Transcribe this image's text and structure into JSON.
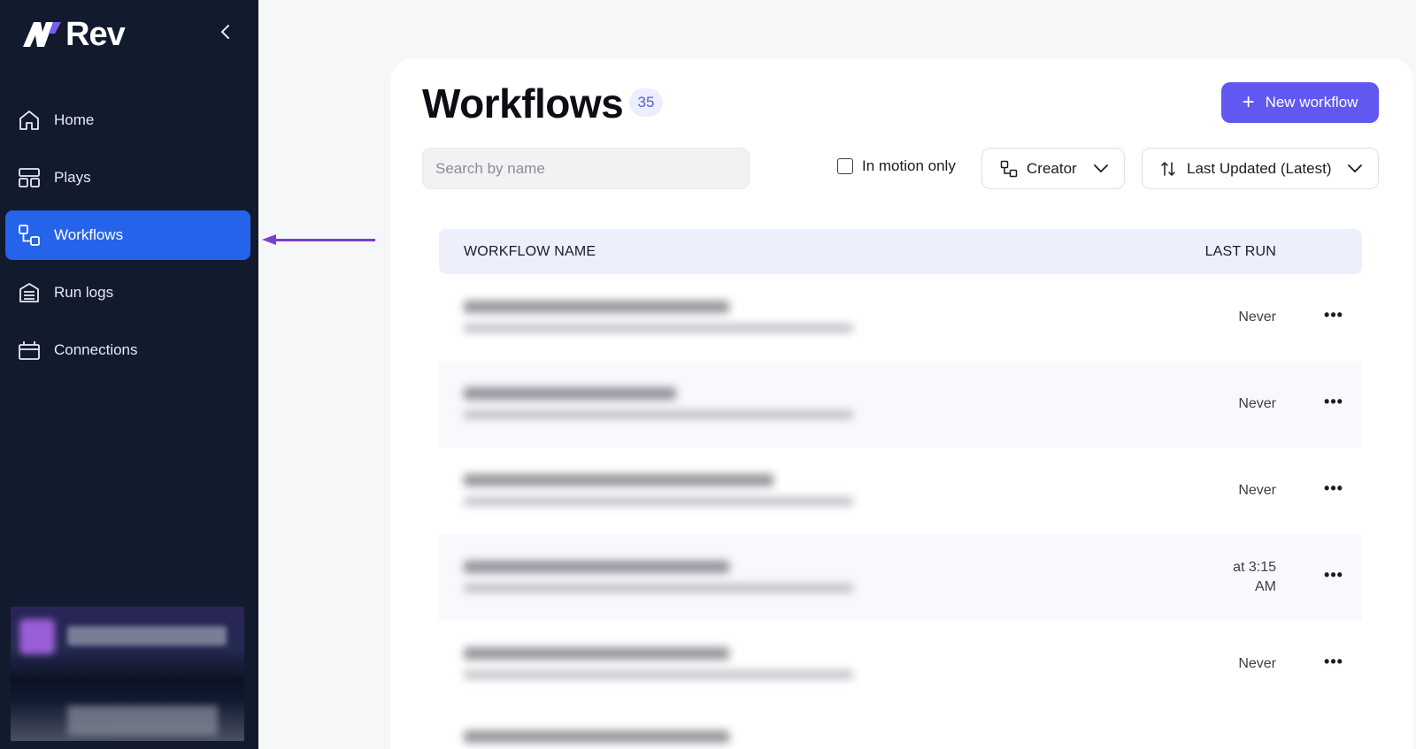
{
  "app": {
    "name": "Rev"
  },
  "sidebar": {
    "items": [
      {
        "label": "Home",
        "icon": "home-icon",
        "active": false
      },
      {
        "label": "Plays",
        "icon": "layout-icon",
        "active": false
      },
      {
        "label": "Workflows",
        "icon": "workflow-icon",
        "active": true
      },
      {
        "label": "Run logs",
        "icon": "database-icon",
        "active": false
      },
      {
        "label": "Connections",
        "icon": "connections-icon",
        "active": false
      }
    ]
  },
  "page": {
    "title": "Workflows",
    "count": "35",
    "new_button_label": "New workflow"
  },
  "filters": {
    "search_placeholder": "Search by name",
    "motion_label": "In motion only",
    "creator_label": "Creator",
    "sort_label": "Last Updated (Latest)"
  },
  "table": {
    "columns": [
      "WORKFLOW NAME",
      "LAST RUN"
    ],
    "rows": [
      {
        "last_run": "Never"
      },
      {
        "last_run": "Never"
      },
      {
        "last_run": "Never"
      },
      {
        "last_run": "at 3:15 AM"
      },
      {
        "last_run": "Never"
      }
    ]
  },
  "colors": {
    "sidebar_bg": "#121a2e",
    "active_nav": "#2563eb",
    "primary_button": "#6058f0",
    "annotation_arrow": "#7a3fd0"
  }
}
